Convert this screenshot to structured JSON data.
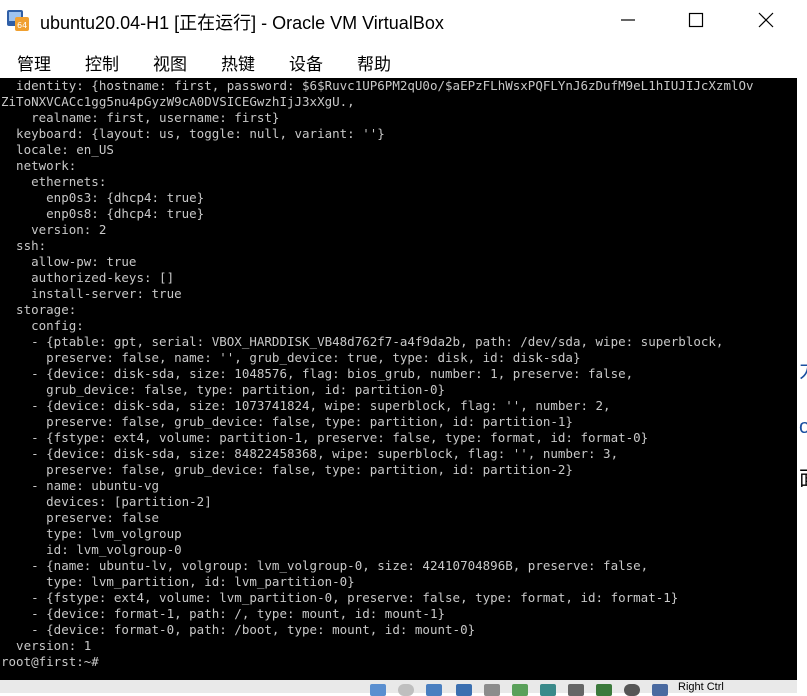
{
  "window": {
    "title": "ubuntu20.04-H1 [正在运行] - Oracle VM VirtualBox",
    "app_icon": "virtualbox-icon",
    "controls": [
      "minimize-icon",
      "maximize-icon",
      "close-icon"
    ]
  },
  "menu": {
    "items": [
      {
        "label": "管理"
      },
      {
        "label": "控制"
      },
      {
        "label": "视图"
      },
      {
        "label": "热键"
      },
      {
        "label": "设备"
      },
      {
        "label": "帮助"
      }
    ]
  },
  "terminal": {
    "lines": [
      "  identity: {hostname: first, password: $6$Ruvc1UP6PM2qU0o/$aEPzFLhWsxPQFLYnJ6zDufM9eL1hIUJIJcXzmlOv",
      "ZiToNXVCACc1gg5nu4pGyzW9cA0DVSICEGwzhIjJ3xXgU.,",
      "    realname: first, username: first}",
      "  keyboard: {layout: us, toggle: null, variant: ''}",
      "  locale: en_US",
      "  network:",
      "    ethernets:",
      "      enp0s3: {dhcp4: true}",
      "      enp0s8: {dhcp4: true}",
      "    version: 2",
      "  ssh:",
      "    allow-pw: true",
      "    authorized-keys: []",
      "    install-server: true",
      "  storage:",
      "    config:",
      "    - {ptable: gpt, serial: VBOX_HARDDISK_VB48d762f7-a4f9da2b, path: /dev/sda, wipe: superblock,",
      "      preserve: false, name: '', grub_device: true, type: disk, id: disk-sda}",
      "    - {device: disk-sda, size: 1048576, flag: bios_grub, number: 1, preserve: false,",
      "      grub_device: false, type: partition, id: partition-0}",
      "    - {device: disk-sda, size: 1073741824, wipe: superblock, flag: '', number: 2,",
      "      preserve: false, grub_device: false, type: partition, id: partition-1}",
      "    - {fstype: ext4, volume: partition-1, preserve: false, type: format, id: format-0}",
      "    - {device: disk-sda, size: 84822458368, wipe: superblock, flag: '', number: 3,",
      "      preserve: false, grub_device: false, type: partition, id: partition-2}",
      "    - name: ubuntu-vg",
      "      devices: [partition-2]",
      "      preserve: false",
      "      type: lvm_volgroup",
      "      id: lvm_volgroup-0",
      "    - {name: ubuntu-lv, volgroup: lvm_volgroup-0, size: 42410704896B, preserve: false,",
      "      type: lvm_partition, id: lvm_partition-0}",
      "    - {fstype: ext4, volume: lvm_partition-0, preserve: false, type: format, id: format-1}",
      "    - {device: format-1, path: /, type: mount, id: mount-1}",
      "    - {device: format-0, path: /boot, type: mount, id: mount-0}",
      "  version: 1",
      "root@first:~#"
    ]
  },
  "statusbar": {
    "icons": [
      "hard-disk-icon",
      "optical-disk-icon",
      "audio-icon",
      "network-icon",
      "usb-icon",
      "shared-folder-icon",
      "display-icon",
      "video-capture-icon",
      "cpu-icon",
      "mouse-integration-icon",
      "host-key-icon"
    ],
    "host_key_text": "Right Ctrl"
  },
  "colors": {
    "terminal_bg": "#000000",
    "terminal_fg": "#c8c8c8",
    "titlebar_bg": "#ffffff",
    "statusbar_bg": "#e9e9e9"
  }
}
